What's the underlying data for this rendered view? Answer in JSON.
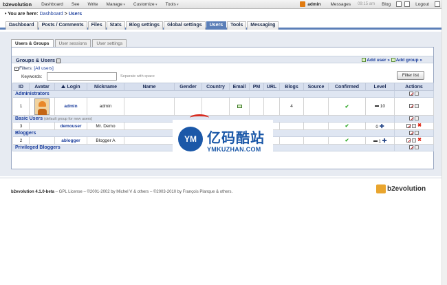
{
  "topbar": {
    "brand": "b2evolution",
    "items": [
      {
        "label": "Dashboard",
        "arrow": false
      },
      {
        "label": "See",
        "arrow": false
      },
      {
        "label": "Write",
        "arrow": false
      },
      {
        "label": "Manage",
        "arrow": true
      },
      {
        "label": "Customize",
        "arrow": true
      },
      {
        "label": "Tools",
        "arrow": true
      }
    ],
    "user": "admin",
    "messages": "Messages",
    "time": "09:15 am",
    "blog": "Blog",
    "logout": "Logout"
  },
  "breadcrumb": {
    "prefix": "• You are here:",
    "dashboard": "Dashboard",
    "sep": ">",
    "current": "Users"
  },
  "main_nav": [
    "Dashboard",
    "Posts / Comments",
    "Files",
    "Stats",
    "Blog settings",
    "Global settings",
    "Users",
    "Tools",
    "Messaging"
  ],
  "main_nav_active": "Users",
  "sub_tabs": [
    "Users & Groups",
    "User sessions",
    "User settings"
  ],
  "panel": {
    "title": "Groups & Users",
    "add_user": "Add user »",
    "add_group": "Add group »",
    "filters_label": "Filters:",
    "filters_value": "[All users]",
    "keywords_label": "Keywords:",
    "keywords_value": "",
    "keywords_hint": "Separate with space",
    "filter_button": "Filter list"
  },
  "columns": [
    "ID",
    "Avatar",
    "Login",
    "Nickname",
    "Name",
    "Gender",
    "Country",
    "Email",
    "PM",
    "URL",
    "Blogs",
    "Source",
    "Confirmed",
    "Level",
    "Actions"
  ],
  "groups": [
    {
      "name": "Administrators",
      "note": "",
      "users": [
        {
          "id": "1",
          "login": "admin",
          "nickname": "admin",
          "blogs": "4",
          "level": "10",
          "has_avatar": true,
          "email": true,
          "deletable": false
        }
      ]
    },
    {
      "name": "Basic Users",
      "note": "(default group for new users)",
      "users": [
        {
          "id": "3",
          "login": "demouser",
          "nickname": "Mr. Demo",
          "blogs": "",
          "level": "0",
          "has_avatar": false,
          "email": false,
          "deletable": true
        }
      ]
    },
    {
      "name": "Bloggers",
      "note": "",
      "users": [
        {
          "id": "2",
          "login": "ablogger",
          "nickname": "Blogger A",
          "blogs": "",
          "level": "1",
          "has_avatar": false,
          "email": false,
          "deletable": true
        }
      ]
    },
    {
      "name": "Privileged Bloggers",
      "note": "",
      "users": []
    }
  ],
  "footer": {
    "version": "b2evolution 4.1.0-beta",
    "license": " – GPL License – ©2001-2002 by Michel V & others – ©2003-2010 by François Planque & others.",
    "logo": "b2evolution"
  },
  "watermark": {
    "logo": "YM",
    "title": "亿码酷站",
    "sub": "YMKUZHAN.COM"
  }
}
